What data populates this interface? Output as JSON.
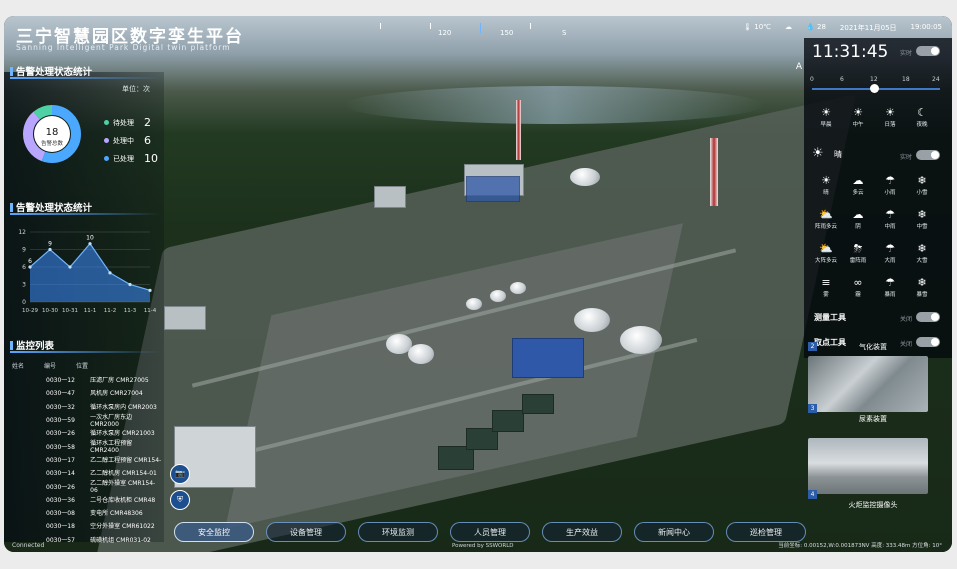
{
  "header": {
    "title": "三宁智慧园区数字孪生平台",
    "subtitle": "Sanning Intelligent Park Digital twin platform",
    "compass_labels": [
      "120",
      "150",
      "S"
    ],
    "temperature": "10℃",
    "humidity": "28",
    "date": "2021年11月05日",
    "time": "19:00:05"
  },
  "alarm_panel": {
    "title": "告警处理状态统计",
    "unit": "单位：次",
    "total": "18",
    "total_label": "告警总数",
    "items": [
      {
        "label": "待处理",
        "value": "2",
        "color": "#4fd1a6"
      },
      {
        "label": "处理中",
        "value": "6",
        "color": "#b9a7ff"
      },
      {
        "label": "已处理",
        "value": "10",
        "color": "#4aa8ff"
      }
    ]
  },
  "trend_panel": {
    "title": "告警处理状态统计",
    "y_ticks": [
      "12",
      "9",
      "6",
      "3",
      "0"
    ],
    "point_labels": [
      "6",
      "9",
      "10"
    ]
  },
  "chart_data": {
    "type": "area",
    "x": [
      "10-29",
      "10-30",
      "10-31",
      "11-1",
      "11-2",
      "11-3",
      "11-4"
    ],
    "series": [
      {
        "values": [
          6,
          9,
          6,
          10,
          5,
          3,
          2
        ]
      }
    ],
    "ylim": [
      0,
      12
    ]
  },
  "monitor_list": {
    "title": "监控列表",
    "columns": [
      "姓名",
      "编号",
      "位置"
    ],
    "rows": [
      {
        "id": "0030一12",
        "loc": "压滤厂房  CMR27005"
      },
      {
        "id": "0030一47",
        "loc": "风机房  CMR27004"
      },
      {
        "id": "0030一32",
        "loc": "循环水泵房内  CMR2003"
      },
      {
        "id": "0030一59",
        "loc": "一次水厂房东边  CMR2000"
      },
      {
        "id": "0030一26",
        "loc": "循环水泵房  CMR21003"
      },
      {
        "id": "0030一58",
        "loc": "循环水工程预留  CMR2400"
      },
      {
        "id": "0030一17",
        "loc": "乙二醇工程预留  CMR154-"
      },
      {
        "id": "0030一14",
        "loc": "乙二醇机房  CMR154-01"
      },
      {
        "id": "0030一26",
        "loc": "乙二醇外操室  CMR154-06"
      },
      {
        "id": "0030一36",
        "loc": "二号仓库收机柜  CMR48"
      },
      {
        "id": "0030一08",
        "loc": "变电所  CMR48306"
      },
      {
        "id": "0030一18",
        "loc": "空分外操室  CMR61022"
      },
      {
        "id": "0030一57",
        "loc": "硫磺机组  CMR031-02"
      }
    ]
  },
  "right_panel": {
    "clock": "11:31:45",
    "realtime_label": "实时",
    "slider_ticks": [
      "0",
      "6",
      "12",
      "18",
      "24"
    ],
    "times_of_day": [
      "早晨",
      "中午",
      "日落",
      "夜晚"
    ],
    "weather_label": "晴",
    "weather_items": [
      "晴",
      "多云",
      "小雨",
      "小雪",
      "阵雨多云",
      "阴",
      "中雨",
      "中雪",
      "大阵多云",
      "雷阵雨",
      "大雨",
      "大雪",
      "雾",
      "霾",
      "暴雨",
      "暴雪"
    ],
    "measure_tool": "测量工具",
    "point_tool": "取点工具",
    "off_label": "关闭"
  },
  "cameras": [
    {
      "no": "2",
      "caption": "气化装置"
    },
    {
      "no": "3",
      "caption": "尿素装置"
    },
    {
      "no": "4",
      "caption": "火炬监控摄像头"
    }
  ],
  "nav": [
    "安全监控",
    "设备管理",
    "环境监测",
    "人员管理",
    "生产效益",
    "新闻中心",
    "巡检管理"
  ],
  "status": {
    "connected": "Connected",
    "powered": "Powered by SSWORLD",
    "coords": "当前坐标: 0.00152,W:0.001873NV    高度: 333.48m  方位角: 10°"
  }
}
